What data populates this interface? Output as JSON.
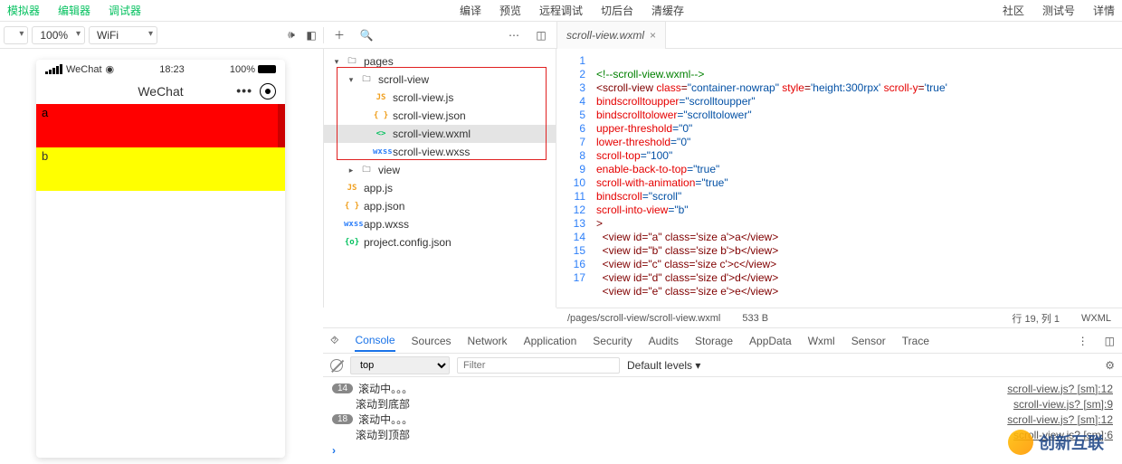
{
  "topTabs": {
    "left": [
      "模拟器",
      "编辑器",
      "调试器"
    ],
    "mid": [
      "编译",
      "预览",
      "远程调试",
      "切后台",
      "清缓存"
    ],
    "right": [
      "社区",
      "测试号",
      "详情"
    ]
  },
  "simControls": {
    "zoom": "100%",
    "network": "WiFi"
  },
  "openTab": {
    "name": "scroll-view.wxml"
  },
  "phone": {
    "carrier": "WeChat",
    "time": "18:23",
    "battery": "100%",
    "title": "WeChat",
    "rows": {
      "a": "a",
      "b": "b"
    }
  },
  "tree": {
    "root": "pages",
    "scrollView": "scroll-view",
    "files": {
      "js": "scroll-view.js",
      "json": "scroll-view.json",
      "wxml": "scroll-view.wxml",
      "wxss": "scroll-view.wxss"
    },
    "view": "view",
    "appjs": "app.js",
    "appjson": "app.json",
    "appwxss": "app.wxss",
    "config": "project.config.json"
  },
  "code": {
    "lines": [
      "1",
      "2",
      "3",
      "4",
      "5",
      "6",
      "7",
      "8",
      "9",
      "10",
      "11",
      "12",
      "13",
      "14",
      "15",
      "16",
      "17"
    ],
    "l1": "<!--scroll-view.wxml-->",
    "l2a": "<scroll-view ",
    "l2b": "class",
    "l2c": "=",
    "l2d": "\"container-nowrap\"",
    "l2e": " style",
    "l2f": "=",
    "l2g": "'height:300rpx'",
    "l2h": " scroll-y",
    "l2i": "=",
    "l2j": "'true'",
    "l3a": "bindscrolltoupper",
    "l3b": "=\"scrolltoupper\"",
    "l4a": "bindscrolltolower",
    "l4b": "=\"scrolltolower\"",
    "l5a": "upper-threshold",
    "l5b": "=\"0\"",
    "l6a": "lower-threshold",
    "l6b": "=\"0\"",
    "l7a": "scroll-top",
    "l7b": "=\"100\"",
    "l8a": "enable-back-to-top",
    "l8b": "=\"true\"",
    "l9a": "scroll-with-animation",
    "l9b": "=\"true\"",
    "l10a": "bindscroll",
    "l10b": "=\"scroll\"",
    "l11a": "scroll-into-view",
    "l11b": "=\"b\"",
    "l12": ">",
    "v13": "  <view id=\"a\" class='size a'>a</view>",
    "v14": "  <view id=\"b\" class='size b'>b</view>",
    "v15": "  <view id=\"c\" class='size c'>c</view>",
    "v16": "  <view id=\"d\" class='size d'>d</view>",
    "v17": "  <view id=\"e\" class='size e'>e</view>"
  },
  "edStatus": {
    "path": "/pages/scroll-view/scroll-view.wxml",
    "size": "533 B",
    "pos": "行 19, 列 1",
    "lang": "WXML"
  },
  "devtools": {
    "tabs": [
      "Console",
      "Sources",
      "Network",
      "Application",
      "Security",
      "Audits",
      "Storage",
      "AppData",
      "Wxml",
      "Sensor",
      "Trace"
    ],
    "ctx": "top",
    "filterPH": "Filter",
    "level": "Default levels ▾",
    "rows": [
      {
        "badge": "14",
        "msg": "滚动中。。。",
        "link": "scroll-view.js? [sm]:12"
      },
      {
        "msg": "滚动到底部",
        "link": "scroll-view.js? [sm]:9"
      },
      {
        "badge": "18",
        "msg": "滚动中。。。",
        "link": "scroll-view.js? [sm]:12"
      },
      {
        "msg": "滚动到顶部",
        "link": "scroll-view.js? [sm]:6"
      }
    ]
  },
  "watermark": "创新互联"
}
